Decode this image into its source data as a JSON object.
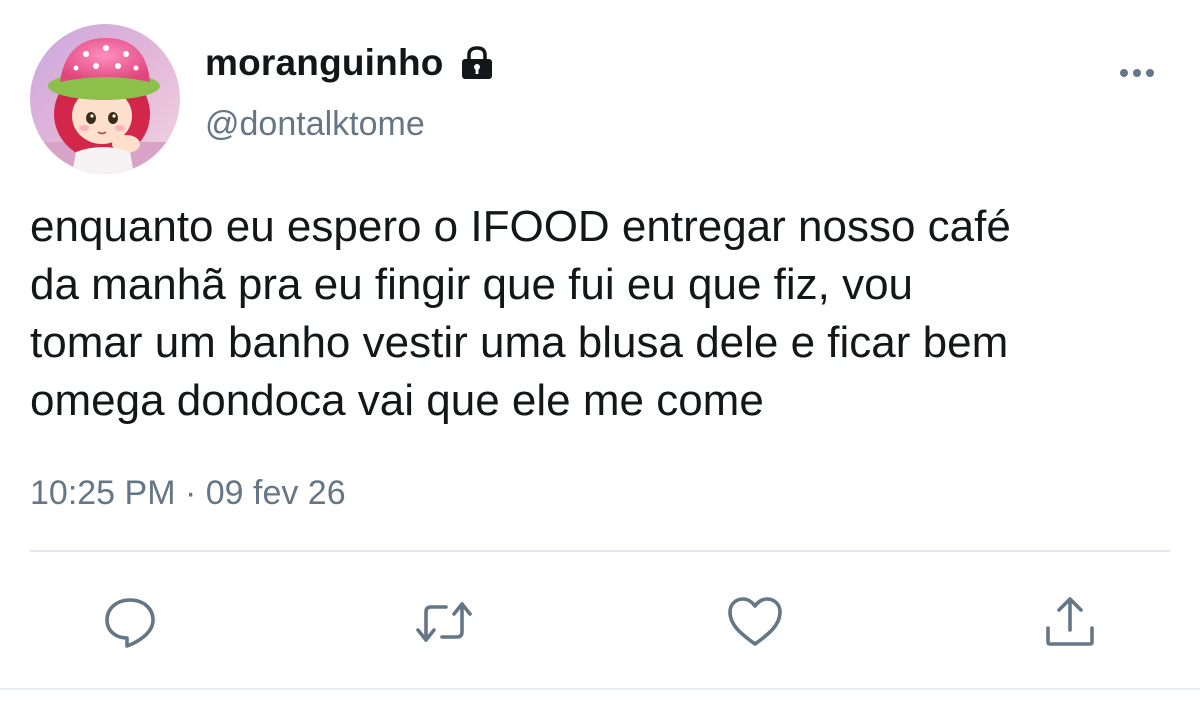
{
  "user": {
    "display_name": "moranguinho",
    "handle": "@dontalktome",
    "avatar_icon": "strawberry-shortcake-avatar",
    "protected_icon": "lock-icon"
  },
  "tweet": {
    "text": "enquanto eu espero o IFOOD entregar nosso café\nda manhã pra eu fingir que fui eu que fiz, vou\ntomar um banho vestir uma blusa dele e ficar bem\nomega dondoca vai que ele me come",
    "timestamp": "10:25 PM · 09 fev 26"
  },
  "actions": [
    {
      "name": "reply",
      "icon": "reply-icon"
    },
    {
      "name": "retweet",
      "icon": "retweet-icon"
    },
    {
      "name": "like",
      "icon": "heart-icon"
    },
    {
      "name": "share",
      "icon": "share-icon"
    }
  ],
  "colors": {
    "text_primary": "#14171a",
    "text_secondary": "#657786",
    "icon": "#657786",
    "divider": "#e1e8ed"
  }
}
